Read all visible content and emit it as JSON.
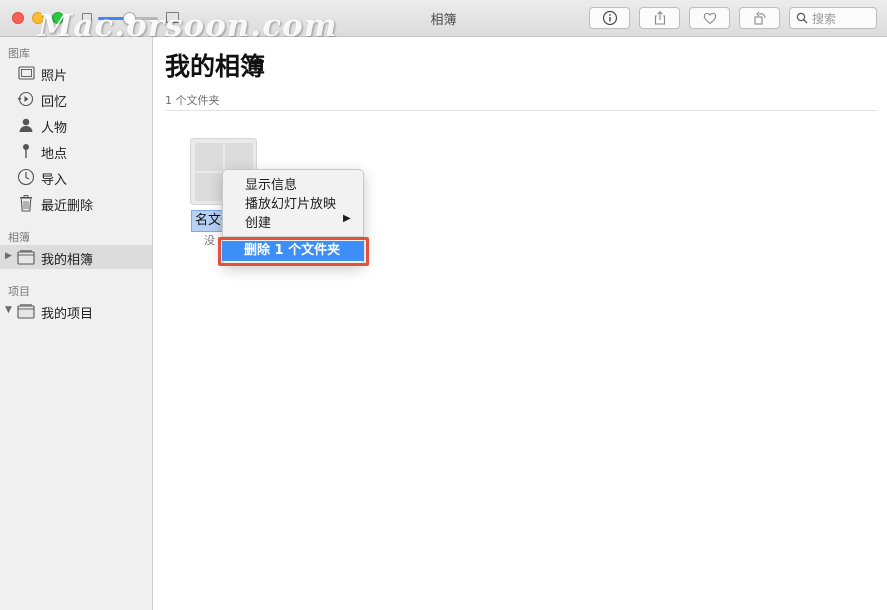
{
  "window": {
    "title": "相簿",
    "watermark": "Mac.orsoon.com",
    "zoom_level": 0.52
  },
  "toolbar": {
    "buttons": [
      {
        "name": "info-icon"
      },
      {
        "name": "share-icon"
      },
      {
        "name": "heart-icon"
      },
      {
        "name": "rotate-icon"
      }
    ],
    "search_placeholder": "搜索"
  },
  "sidebar": {
    "library_header": "图库",
    "library_items": [
      {
        "label": "照片",
        "icon": "photos-icon"
      },
      {
        "label": "回忆",
        "icon": "memories-icon"
      },
      {
        "label": "人物",
        "icon": "people-icon"
      },
      {
        "label": "地点",
        "icon": "places-icon"
      },
      {
        "label": "导入",
        "icon": "import-icon"
      },
      {
        "label": "最近删除",
        "icon": "trash-icon"
      }
    ],
    "albums_header": "相簿",
    "albums_items": [
      {
        "label": "我的相簿",
        "icon": "album-folder-icon",
        "selected": true,
        "expanded": false
      }
    ],
    "projects_header": "项目",
    "projects_items": [
      {
        "label": "我的项目",
        "icon": "project-folder-icon",
        "selected": false,
        "expanded": true
      }
    ]
  },
  "main": {
    "title": "我的相簿",
    "subtitle": "1 个文件夹",
    "folder": {
      "name_editing": "名文件",
      "status": "没"
    }
  },
  "context_menu": {
    "items": [
      {
        "label": "显示信息"
      },
      {
        "label": "播放幻灯片放映"
      },
      {
        "label": "创建",
        "submenu": true
      }
    ],
    "submenu_arrow": "▶",
    "selected_item": "删除 1 个文件夹",
    "highlight_color": "#e5503c",
    "selection_color": "#3d8ef6"
  },
  "colors": {
    "accent": "#3c87f4",
    "close": "#fc5f57",
    "minimize": "#fdbc2e",
    "maximize": "#28c840"
  }
}
